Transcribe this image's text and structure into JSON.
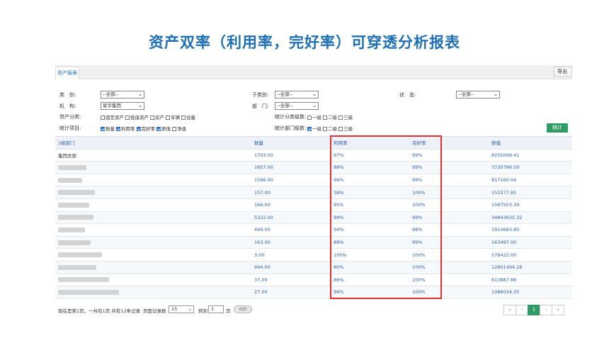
{
  "slide_title": "资产双率（利用率，完好率）可穿透分析报表",
  "tab_label": "资产报表",
  "export_label": "导出",
  "filters": {
    "category_label": "类　别:",
    "category_value": "--全部--",
    "subcategory_label": "子类别:",
    "subcategory_value": "--全部--",
    "status_label": "状　态:",
    "status_value": "--全部--",
    "org_label": "机　构:",
    "org_value": "星华集团",
    "dept_label": "部　门:",
    "dept_value": "--全部--",
    "asset_class_label": "资产分类:",
    "asset_class_options": [
      {
        "label": "固定资产",
        "checked": false
      },
      {
        "label": "低值资产",
        "checked": false
      },
      {
        "label": "房产",
        "checked": false
      },
      {
        "label": "车辆",
        "checked": false
      },
      {
        "label": "设备",
        "checked": false
      }
    ],
    "stat_class_level_label": "统计分类级数:",
    "stat_class_level_options": [
      {
        "label": "一级",
        "checked": false
      },
      {
        "label": "二级",
        "checked": false
      },
      {
        "label": "三级",
        "checked": false
      }
    ],
    "stat_items_label": "统计项目:",
    "stat_items_options": [
      {
        "label": "数量",
        "checked": true
      },
      {
        "label": "利用率",
        "checked": true
      },
      {
        "label": "完好率",
        "checked": true
      },
      {
        "label": "原值",
        "checked": true
      },
      {
        "label": "净值",
        "checked": false
      }
    ],
    "stat_dept_level_label": "统计部门级数:",
    "stat_dept_level_options": [
      {
        "label": "一级",
        "checked": true
      },
      {
        "label": "二级",
        "checked": false
      },
      {
        "label": "三级",
        "checked": false
      }
    ],
    "stat_button": "统计"
  },
  "table": {
    "columns": [
      "1级部门",
      "数量",
      "利用率",
      "完好率",
      "原值"
    ],
    "rows": [
      {
        "name": "集团总部",
        "qty": "1703.00",
        "util": "97%",
        "good": "99%",
        "value": "8255049.41",
        "blurred": false
      },
      {
        "name": "",
        "qty": "1857.00",
        "util": "88%",
        "good": "99%",
        "value": "3720796.59",
        "blurred": true
      },
      {
        "name": "",
        "qty": "1596.00",
        "util": "96%",
        "good": "99%",
        "value": "817160.04",
        "blurred": true
      },
      {
        "name": "",
        "qty": "157.00",
        "util": "38%",
        "good": "100%",
        "value": "151577.85",
        "blurred": true
      },
      {
        "name": "",
        "qty": "166.00",
        "util": "95%",
        "good": "100%",
        "value": "1587503.39",
        "blurred": true
      },
      {
        "name": "",
        "qty": "5322.00",
        "util": "99%",
        "good": "99%",
        "value": "34843935.32",
        "blurred": true
      },
      {
        "name": "",
        "qty": "499.00",
        "util": "94%",
        "good": "98%",
        "value": "1914683.80",
        "blurred": true
      },
      {
        "name": "",
        "qty": "163.00",
        "util": "88%",
        "good": "99%",
        "value": "163497.00",
        "blurred": true
      },
      {
        "name": "",
        "qty": "3.00",
        "util": "100%",
        "good": "100%",
        "value": "576422.00",
        "blurred": true
      },
      {
        "name": "",
        "qty": "994.00",
        "util": "80%",
        "good": "100%",
        "value": "12801494.28",
        "blurred": true
      },
      {
        "name": "",
        "qty": "37.00",
        "util": "86%",
        "good": "100%",
        "value": "613887.88",
        "blurred": true
      },
      {
        "name": "",
        "qty": "27.00",
        "util": "96%",
        "good": "100%",
        "value": "1086034.35",
        "blurred": true
      }
    ]
  },
  "footer": {
    "info": "现在是第1页，一共有1页 共有12条记录",
    "page_size_label": "页面记录数",
    "page_size": "15",
    "goto_label": "转到",
    "goto_value": "1",
    "page_label": "页",
    "go_button": "GO",
    "pager": {
      "first": "«",
      "prev": "‹",
      "current": "1",
      "next": "›",
      "last": "»"
    }
  }
}
